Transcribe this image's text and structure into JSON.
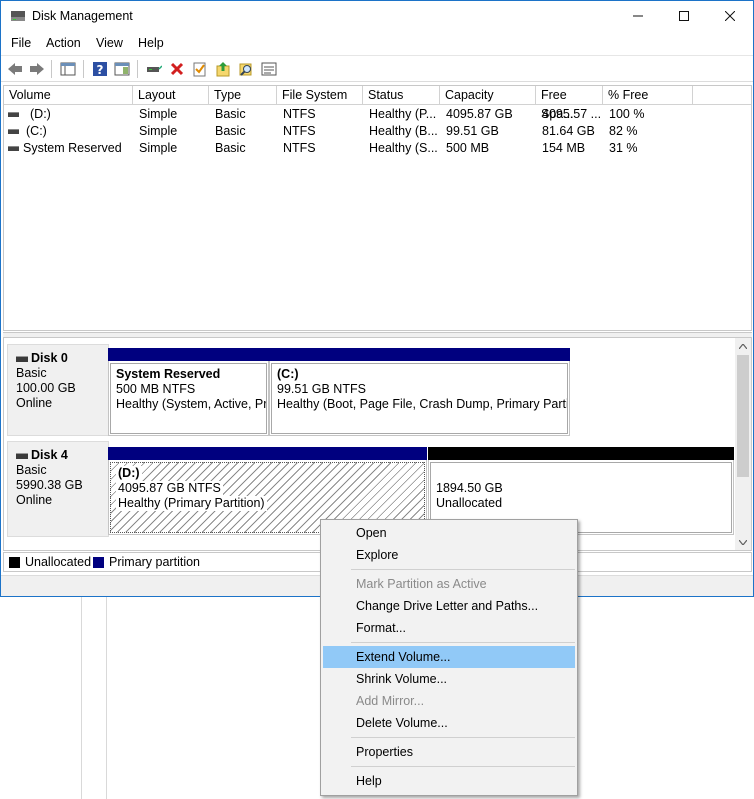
{
  "window": {
    "title": "Disk Management",
    "accent": "#1c73c8"
  },
  "menubar": [
    "File",
    "Action",
    "View",
    "Help"
  ],
  "toolbar": {
    "icons": [
      "back-arrow-icon",
      "forward-arrow-icon",
      "console-tree-icon",
      "help-icon",
      "action-pane-icon",
      "connect-disk-icon",
      "delete-icon",
      "properties-check-icon",
      "rescan-icon",
      "find-icon",
      "settings-list-icon"
    ]
  },
  "volume_table": {
    "columns": [
      "Volume",
      "Layout",
      "Type",
      "File System",
      "Status",
      "Capacity",
      "Free Spa...",
      "% Free"
    ],
    "rows": [
      [
        "(D:)",
        "Simple",
        "Basic",
        "NTFS",
        "Healthy (P...",
        "4095.87 GB",
        "4095.57 ...",
        "100 %"
      ],
      [
        "(C:)",
        "Simple",
        "Basic",
        "NTFS",
        "Healthy (B...",
        "99.51 GB",
        "81.64 GB",
        "82 %"
      ],
      [
        "System Reserved",
        "Simple",
        "Basic",
        "NTFS",
        "Healthy (S...",
        "500 MB",
        "154 MB",
        "31 %"
      ]
    ]
  },
  "disks": [
    {
      "name": "Disk 0",
      "type": "Basic",
      "size": "100.00 GB",
      "status": "Online",
      "partitions": [
        {
          "label": "System Reserved",
          "detail": "500 MB NTFS",
          "status": "Healthy (System, Active, Pri"
        },
        {
          "label": "(C:)",
          "detail": "99.51 GB NTFS",
          "status": "Healthy (Boot, Page File, Crash Dump, Primary Partitic"
        }
      ]
    },
    {
      "name": "Disk 4",
      "type": "Basic",
      "size": "5990.38 GB",
      "status": "Online",
      "partitions": [
        {
          "label": "(D:)",
          "detail": "4095.87 GB NTFS",
          "status": "Healthy (Primary Partition)"
        },
        {
          "label": "",
          "detail": "1894.50 GB",
          "status": "Unallocated"
        }
      ]
    }
  ],
  "legend": {
    "unallocated": "Unallocated",
    "primary": "Primary partition",
    "unallocated_color": "#000000",
    "primary_color": "#00007f"
  },
  "context_menu": {
    "items": [
      {
        "label": "Open",
        "enabled": true
      },
      {
        "label": "Explore",
        "enabled": true
      },
      {
        "label": "Mark Partition as Active",
        "enabled": false
      },
      {
        "label": "Change Drive Letter and Paths...",
        "enabled": true
      },
      {
        "label": "Format...",
        "enabled": true
      },
      {
        "label": "Extend Volume...",
        "enabled": true,
        "highlighted": true
      },
      {
        "label": "Shrink Volume...",
        "enabled": true
      },
      {
        "label": "Add Mirror...",
        "enabled": false
      },
      {
        "label": "Delete Volume...",
        "enabled": true
      },
      {
        "label": "Properties",
        "enabled": true
      },
      {
        "label": "Help",
        "enabled": true
      }
    ],
    "highlight_color": "#91c9f7"
  }
}
